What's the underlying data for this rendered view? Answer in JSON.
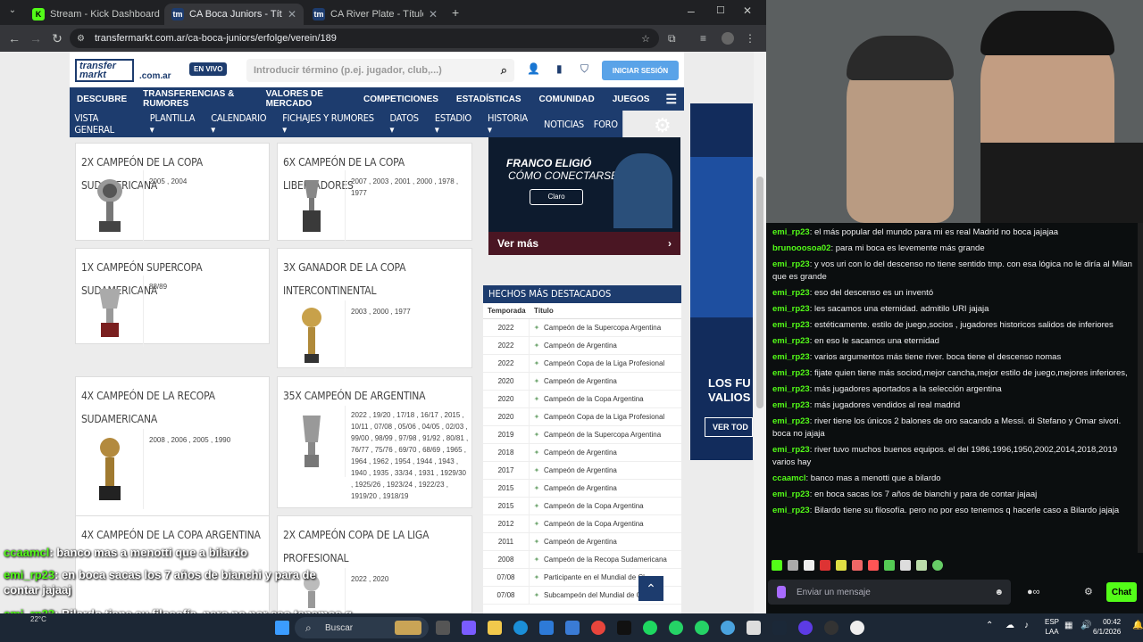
{
  "browser": {
    "tabs": [
      {
        "label": "Stream - Kick Dashboard",
        "active": false
      },
      {
        "label": "CA Boca Juniors - Títulos (clube",
        "active": true
      },
      {
        "label": "CA River Plate - Títulos (clubes",
        "active": false
      }
    ],
    "url": "transfermarkt.com.ar/ca-boca-juniors/erfolge/verein/189"
  },
  "site": {
    "logo_top": "transfer",
    "logo_bottom": "markt",
    "domain": ".com.ar",
    "live": "EN VIVO",
    "search_placeholder": "Introducir término (p.ej. jugador, club,...)",
    "login": "INICIAR SESIÓN",
    "main_nav": [
      "DESCUBRE",
      "TRANSFERENCIAS & RUMORES",
      "VALORES DE MERCADO",
      "COMPETICIONES",
      "ESTADÍSTICAS",
      "COMUNIDAD",
      "JUEGOS"
    ],
    "sub_nav": [
      "VISTA GENERAL",
      "PLANTILLA ▾",
      "CALENDARIO ▾",
      "FICHAJES Y RUMORES ▾",
      "DATOS ▾",
      "ESTADIO ▾",
      "HISTORIA ▾",
      "NOTICIAS",
      "FORO"
    ]
  },
  "titles": [
    {
      "name": "2x Campeón de la Copa Sudamericana",
      "years": "2005 , 2004"
    },
    {
      "name": "6x Campeón de la Copa Libertadores",
      "years": "2007 , 2003 , 2001 , 2000 , 1978 , 1977"
    },
    {
      "name": "1x Campeón Supercopa Sudamericana",
      "years": "88/89"
    },
    {
      "name": "3x Ganador de la Copa Intercontinental",
      "years": "2003 , 2000 , 1977"
    },
    {
      "name": "4x Campeón de la Recopa Sudamericana",
      "years": "2008 , 2006 , 2005 , 1990"
    },
    {
      "name": "35x Campeón de Argentina",
      "years": "2022 , 19/20 , 17/18 , 16/17 , 2015 , 10/11 , 07/08 , 05/06 , 04/05 , 02/03 , 99/00 , 98/99 , 97/98 , 91/92 , 80/81 , 76/77 , 75/76 , 69/70 , 68/69 , 1965 , 1964 , 1962 , 1954 , 1944 , 1943 , 1940 , 1935 , 33/34 , 1931 , 1929/30 , 1925/26 , 1923/24 , 1922/23 , 1919/20 , 1918/19"
    },
    {
      "name": "4x Campeón de la Copa Argentina",
      "years": ""
    },
    {
      "name": "2x Campeón Copa de la Liga Profesional",
      "years": "2022 , 2020"
    }
  ],
  "ad": {
    "line1": "FRANCO ELIGIÓ",
    "line2": "CÓMO CONECTARSE",
    "brand": "Claro",
    "cta": "Ver más"
  },
  "ad2": {
    "line1": "LOS FU",
    "line2": "VALIOS",
    "cta": "VER TOD"
  },
  "highlights": {
    "title": "HECHOS MÁS DESTACADOS",
    "col_season": "Temporada",
    "col_title": "Título",
    "rows": [
      {
        "season": "2022",
        "title": "Campeón de la Supercopa Argentina"
      },
      {
        "season": "2022",
        "title": "Campeón de Argentina"
      },
      {
        "season": "2022",
        "title": "Campeón Copa de la Liga Profesional"
      },
      {
        "season": "2020",
        "title": "Campeón de Argentina"
      },
      {
        "season": "2020",
        "title": "Campeón de la Copa Argentina"
      },
      {
        "season": "2020",
        "title": "Campeón Copa de la Liga Profesional"
      },
      {
        "season": "2019",
        "title": "Campeón de la Supercopa Argentina"
      },
      {
        "season": "2018",
        "title": "Campeón de Argentina"
      },
      {
        "season": "2017",
        "title": "Campeón de Argentina"
      },
      {
        "season": "2015",
        "title": "Campeón de Argentina"
      },
      {
        "season": "2015",
        "title": "Campeón de la Copa Argentina"
      },
      {
        "season": "2012",
        "title": "Campeón de la Copa Argentina"
      },
      {
        "season": "2011",
        "title": "Campeón de Argentina"
      },
      {
        "season": "2008",
        "title": "Campeón de la Recopa Sudamericana"
      },
      {
        "season": "07/08",
        "title": "Participante en el Mundial de Cl"
      },
      {
        "season": "07/08",
        "title": "Subcampeón del Mundial de C"
      }
    ]
  },
  "overlay_chat": [
    {
      "user": "ccaamcl",
      "text": "banco mas a menotti que a bilardo"
    },
    {
      "user": "emi_rp23",
      "text": "en boca sacas los 7 años de bianchi y para de contar jajaaj"
    },
    {
      "user": "emi_rp23",
      "text": "Bilardo tiene su filosofía. pero no por eso tenemos q hacerle caso a Bilardo jajaja"
    }
  ],
  "chat": [
    {
      "user": "emi_rp23",
      "text": "el más popular del mundo para mi es real Madrid no boca jajajaa"
    },
    {
      "user": "brunooosoa02",
      "text": "para mi boca es levemente más grande"
    },
    {
      "user": "emi_rp23",
      "text": "y vos uri con lo del descenso no tiene sentido tmp. con esa lógica no le diría al Milan que es grande"
    },
    {
      "user": "emi_rp23",
      "text": "eso del descenso es un inventó"
    },
    {
      "user": "emi_rp23",
      "text": "les sacamos una eternidad. admitilo URI jajaja"
    },
    {
      "user": "emi_rp23",
      "text": "estéticamente. estilo de juego,socios , jugadores historicos salidos de inferiores"
    },
    {
      "user": "emi_rp23",
      "text": "en eso le sacamos una eternidad"
    },
    {
      "user": "emi_rp23",
      "text": "varios argumentos más tiene river. boca tiene el descenso nomas"
    },
    {
      "user": "emi_rp23",
      "text": "fijate quien tiene más sociod,mejor cancha,mejor estilo de juego,mejores inferiores,"
    },
    {
      "user": "emi_rp23",
      "text": "más jugadores aportados a la selección argentina"
    },
    {
      "user": "emi_rp23",
      "text": "más jugadores vendidos al real madrid"
    },
    {
      "user": "emi_rp23",
      "text": "river tiene los únicos 2 balones de oro sacando a Messi. di Stefano y Omar sivori. boca no jajaja"
    },
    {
      "user": "emi_rp23",
      "text": "river tuvo muchos buenos equipos. el del 1986,1996,1950,2002,2014,2018,2019 varios hay"
    },
    {
      "user": "ccaamcl",
      "text": "banco mas a menotti que a bilardo"
    },
    {
      "user": "emi_rp23",
      "text": "en boca sacas los 7 años de bianchi y para de contar jajaaj"
    },
    {
      "user": "emi_rp23",
      "text": "Bilardo tiene su filosofía. pero no por eso tenemos q hacerle caso a Bilardo jajaja"
    }
  ],
  "chat_input_placeholder": "Enviar un mensaje",
  "chat_button": "Chat",
  "taskbar": {
    "weather": "22°C",
    "search": "Buscar",
    "lang": "ESP",
    "lang2": "LAA",
    "time": "00:42",
    "date": "6/1/2026"
  },
  "colors": {
    "tm_blue": "#1d3c6e",
    "kick_green": "#53fc18"
  }
}
